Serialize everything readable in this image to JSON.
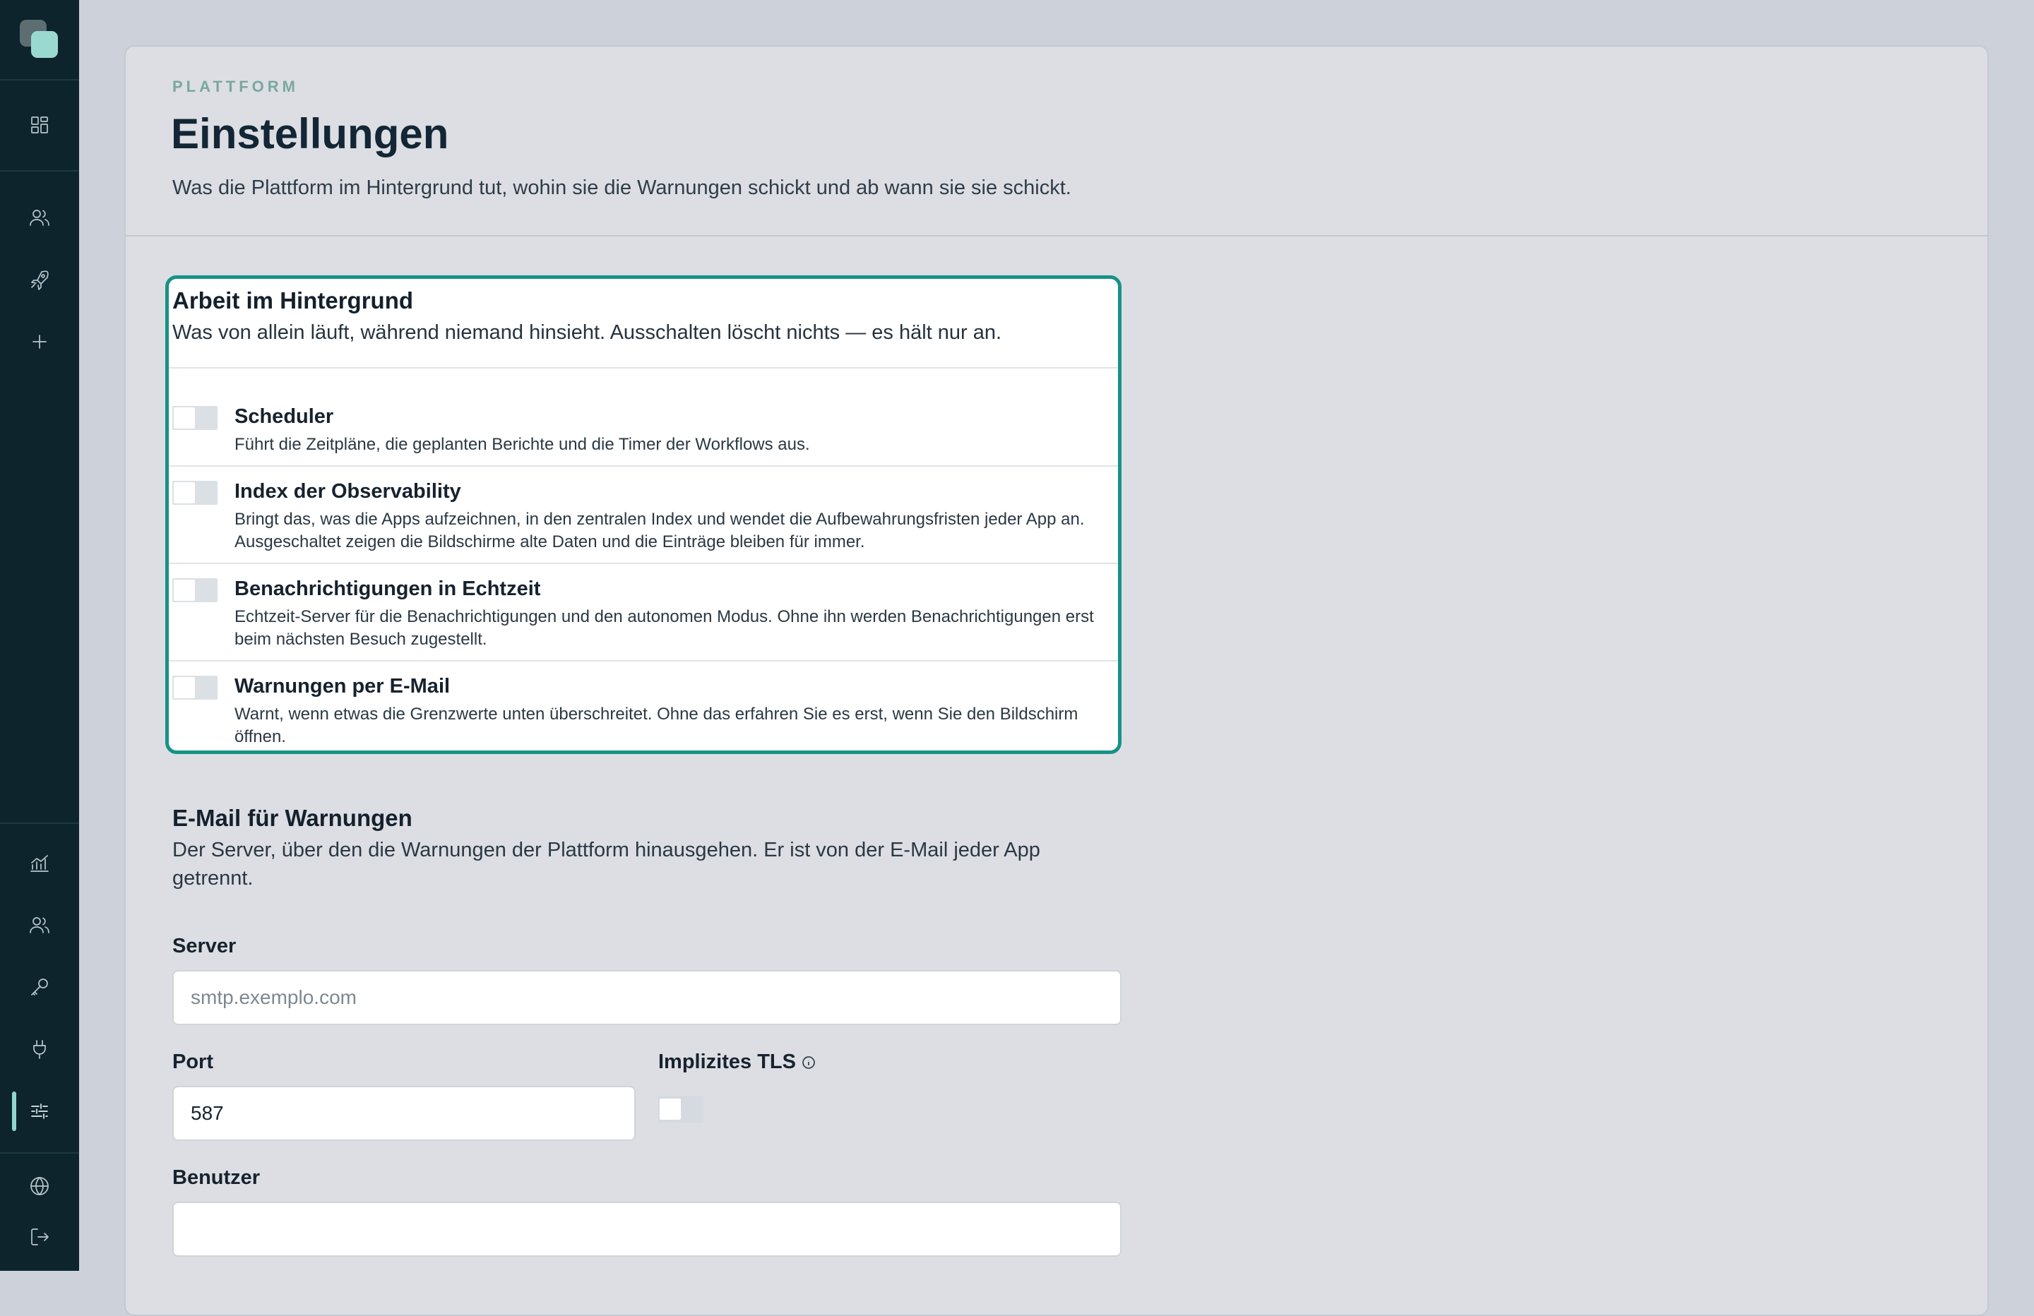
{
  "sidebar": {
    "items": [
      {
        "name": "dashboard",
        "icon": "grid-icon"
      },
      {
        "name": "users",
        "icon": "users-icon"
      },
      {
        "name": "deploy",
        "icon": "rocket-icon"
      },
      {
        "name": "add",
        "icon": "plus-icon"
      },
      {
        "name": "analytics",
        "icon": "chart-icon"
      },
      {
        "name": "team",
        "icon": "users-icon"
      },
      {
        "name": "keys",
        "icon": "key-icon"
      },
      {
        "name": "integrations",
        "icon": "plug-icon"
      },
      {
        "name": "settings",
        "icon": "sliders-icon",
        "active": true
      },
      {
        "name": "language",
        "icon": "globe-icon"
      },
      {
        "name": "logout",
        "icon": "logout-icon"
      }
    ],
    "accent": "#8fd6cc",
    "background": "#0d242d"
  },
  "header": {
    "eyebrow": "PLATTFORM",
    "title": "Einstellungen",
    "subtitle": "Was die Plattform im Hintergrund tut, wohin sie die Warnungen schickt und ab wann sie sie schickt."
  },
  "background_work": {
    "title": "Arbeit im Hintergrund",
    "description": "Was von allein läuft, während niemand hinsieht. Ausschalten löscht nichts — es hält nur an.",
    "accent": "#179287",
    "items": [
      {
        "label": "Scheduler",
        "description": "Führt die Zeitpläne, die geplanten Berichte und die Timer der Workflows aus.",
        "enabled": false
      },
      {
        "label": "Index der Observability",
        "description": "Bringt das, was die Apps aufzeichnen, in den zentralen Index und wendet die Aufbewahrungsfristen jeder App an. Ausgeschaltet zeigen die Bildschirme alte Daten und die Einträge bleiben für immer.",
        "enabled": false
      },
      {
        "label": "Benachrichtigungen in Echtzeit",
        "description": "Echtzeit-Server für die Benachrichtigungen und den autonomen Modus. Ohne ihn werden Benachrichtigungen erst beim nächsten Besuch zugestellt.",
        "enabled": false
      },
      {
        "label": "Warnungen per E-Mail",
        "description": "Warnt, wenn etwas die Grenzwerte unten überschreitet. Ohne das erfahren Sie es erst, wenn Sie den Bildschirm öffnen.",
        "enabled": false
      }
    ]
  },
  "email": {
    "title": "E-Mail für Warnungen",
    "description": "Der Server, über den die Warnungen der Plattform hinausgehen. Er ist von der E-Mail jeder App getrennt.",
    "server_label": "Server",
    "server_value": "",
    "server_placeholder": "smtp.exemplo.com",
    "port_label": "Port",
    "port_value": "587",
    "tls_label": "Implizites TLS",
    "tls_enabled": false,
    "user_label": "Benutzer",
    "user_value": ""
  }
}
